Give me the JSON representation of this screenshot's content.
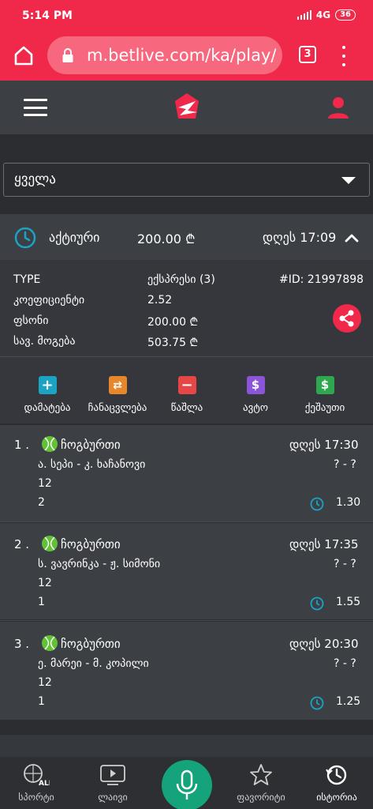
{
  "status_bar": {
    "time": "5:14 PM",
    "network": "4G",
    "battery": "36"
  },
  "browser": {
    "url": "m.betlive.com/ka/play/c",
    "tab_count": "3"
  },
  "filter": {
    "selected": "ყველა"
  },
  "bet": {
    "status": "აქტიური",
    "amount": "200.00 ₾",
    "date": "დღეს 17:09",
    "details": {
      "type_label": "TYPE",
      "type_value": "ექსპრესი (3)",
      "id": "#ID: 21997898",
      "coef_label": "კოეფიციენტი",
      "coef_value": "2.52",
      "stake_label": "ფსონი",
      "stake_value": "200.00 ₾",
      "win_label": "სავ. მოგება",
      "win_value": "503.75 ₾"
    }
  },
  "actions": [
    {
      "label": "დამატება",
      "icon": "plus-icon",
      "color": "#1aa3c2"
    },
    {
      "label": "ჩანაცვლება",
      "icon": "swap-icon",
      "color": "#e7872b"
    },
    {
      "label": "წაშლა",
      "icon": "minus-icon",
      "color": "#e64646"
    },
    {
      "label": "ავტო",
      "icon": "dollar-icon",
      "color": "#8b55d9"
    },
    {
      "label": "ქეშაუთი",
      "icon": "dollar-icon",
      "color": "#2ea84f"
    }
  ],
  "matches": [
    {
      "num": "1 .",
      "sport": "ჩოგბურთი",
      "time": "დღეს 17:30",
      "teams": "ა. სეპი - კ. ხაჩანოვი",
      "score": "? - ?",
      "line": "12",
      "pick": "2",
      "odds": "1.30"
    },
    {
      "num": "2 .",
      "sport": "ჩოგბურთი",
      "time": "დღეს 17:35",
      "teams": "ს. ვავრინკა - ჟ. სიმონი",
      "score": "? - ?",
      "line": "12",
      "pick": "1",
      "odds": "1.55"
    },
    {
      "num": "3 .",
      "sport": "ჩოგბურთი",
      "time": "დღეს 20:30",
      "teams": "ე. მარეი - მ. კოპილი",
      "score": "? - ?",
      "line": "12",
      "pick": "1",
      "odds": "1.25"
    }
  ],
  "bottom_nav": [
    {
      "label": "სპორტი",
      "icon": "sports-ball-icon",
      "badge": "ALL"
    },
    {
      "label": "ლაივი",
      "icon": "play-video-icon"
    },
    {
      "label": "",
      "icon": "microphone-icon"
    },
    {
      "label": "ფავორიტი",
      "icon": "star-icon"
    },
    {
      "label": "ისტორია",
      "icon": "history-icon"
    }
  ],
  "colors": {
    "brand": "#f0284a",
    "accent_teal": "#1aa3c2",
    "mic_green": "#14a37a"
  }
}
